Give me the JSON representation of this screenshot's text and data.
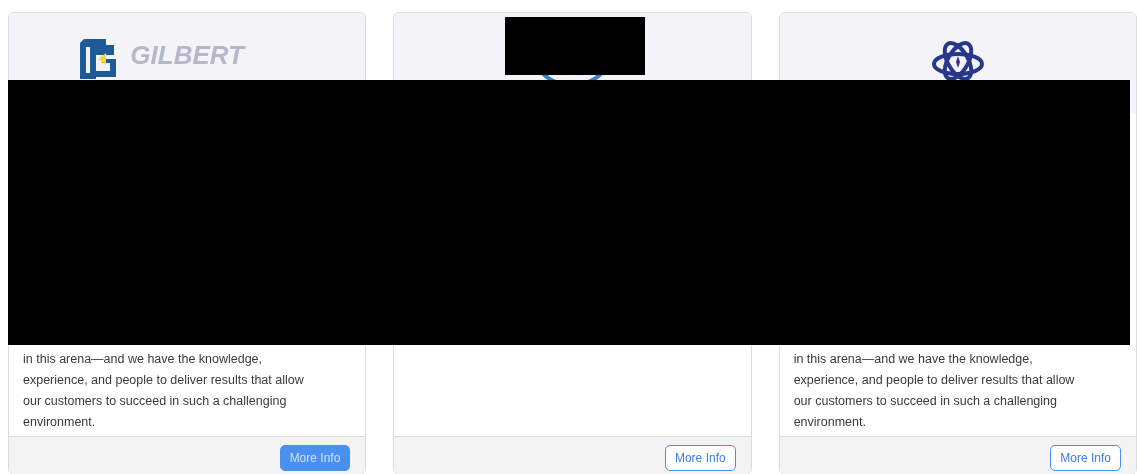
{
  "cards": [
    {
      "logo": {
        "kind": "gilbert",
        "text": "GILBERT"
      },
      "description": [
        "in this arena—and we have the knowledge,",
        "experience, and people to deliver results that allow",
        "our customers to succeed in such a challenging",
        "environment."
      ],
      "button": {
        "label": "More Info",
        "kind": "solid"
      }
    },
    {
      "logo": {
        "kind": "ring"
      },
      "button": {
        "label": "More Info",
        "kind": "outline"
      }
    },
    {
      "logo": {
        "kind": "atom"
      },
      "description": [
        "in this arena—and we have the knowledge,",
        "experience, and people to deliver results that allow",
        "our customers to succeed in such a challenging",
        "environment."
      ],
      "button": {
        "label": "More Info",
        "kind": "outline"
      }
    }
  ]
}
